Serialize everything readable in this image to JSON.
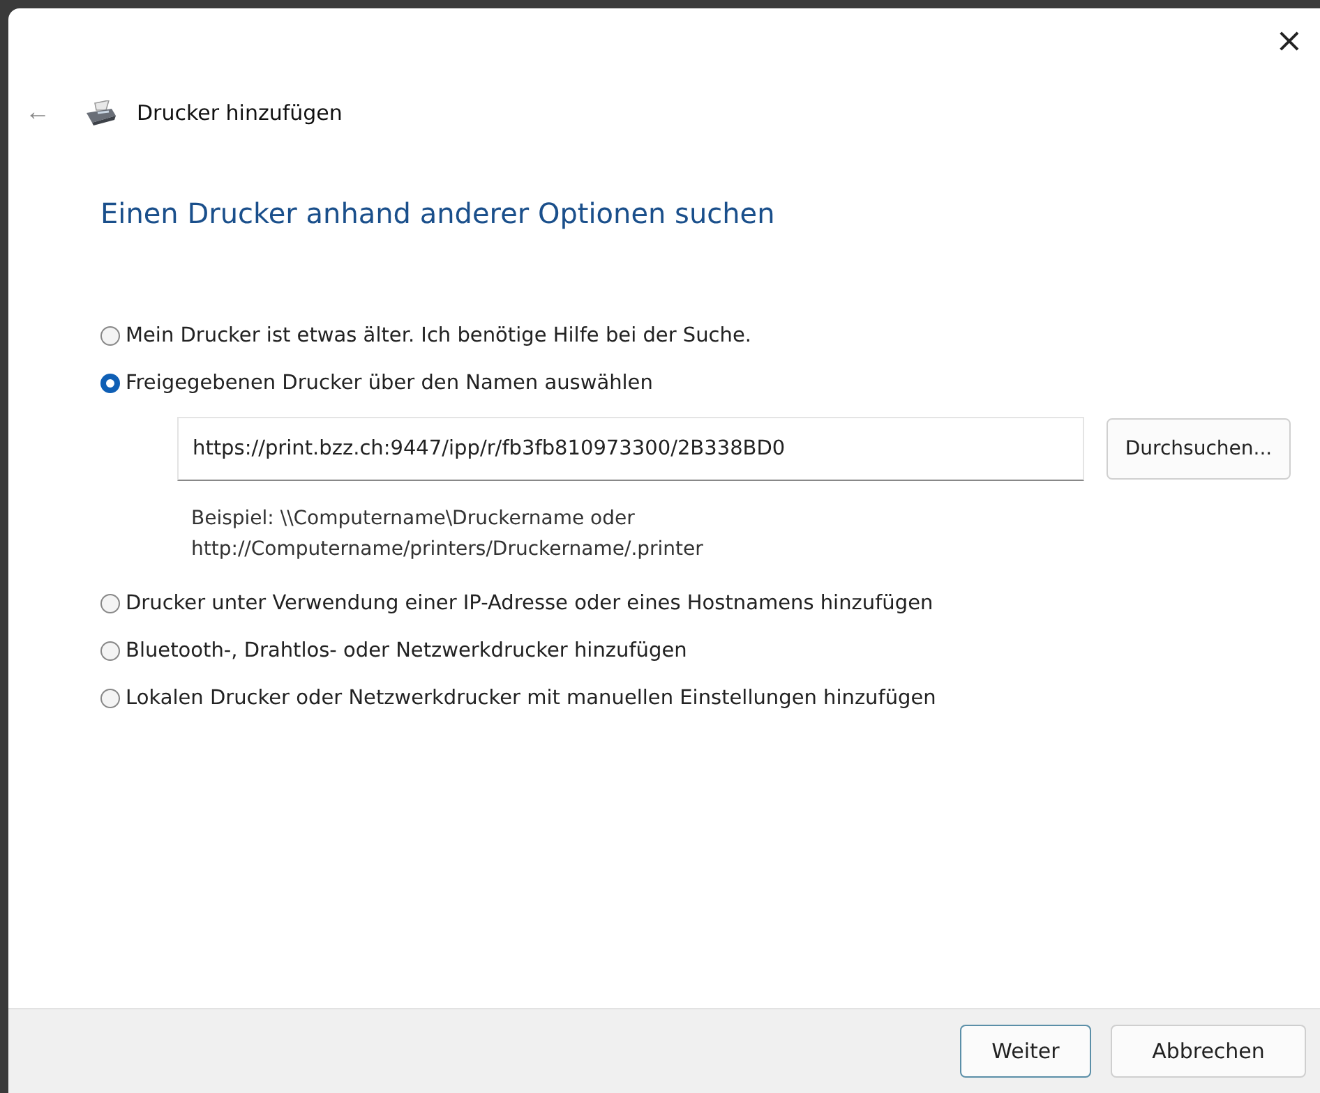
{
  "window": {
    "close": "×",
    "back": "←",
    "title": "Drucker hinzufügen"
  },
  "heading": "Einen Drucker anhand anderer Optionen suchen",
  "options": [
    {
      "label": "Mein Drucker ist etwas älter. Ich benötige Hilfe bei der Suche.",
      "selected": false
    },
    {
      "label": "Freigegebenen Drucker über den Namen auswählen",
      "selected": true,
      "field": {
        "value": "https://print.bzz.ch:9447/ipp/r/fb3fb810973300/2B338BD0"
      },
      "browse_button": "Durchsuchen...",
      "example_lines": [
        "Beispiel: \\\\Computername\\Druckername oder",
        "http://Computername/printers/Druckername/.printer"
      ]
    },
    {
      "label": "Drucker unter Verwendung einer IP-Adresse oder eines Hostnamens hinzufügen",
      "selected": false
    },
    {
      "label": "Bluetooth-, Drahtlos- oder Netzwerkdrucker hinzufügen",
      "selected": false
    },
    {
      "label": "Lokalen Drucker oder Netzwerkdrucker mit manuellen Einstellungen hinzufügen",
      "selected": false
    }
  ],
  "buttons": [
    {
      "label": "Weiter",
      "default": true
    },
    {
      "label": "Abbrechen",
      "default": false
    }
  ]
}
